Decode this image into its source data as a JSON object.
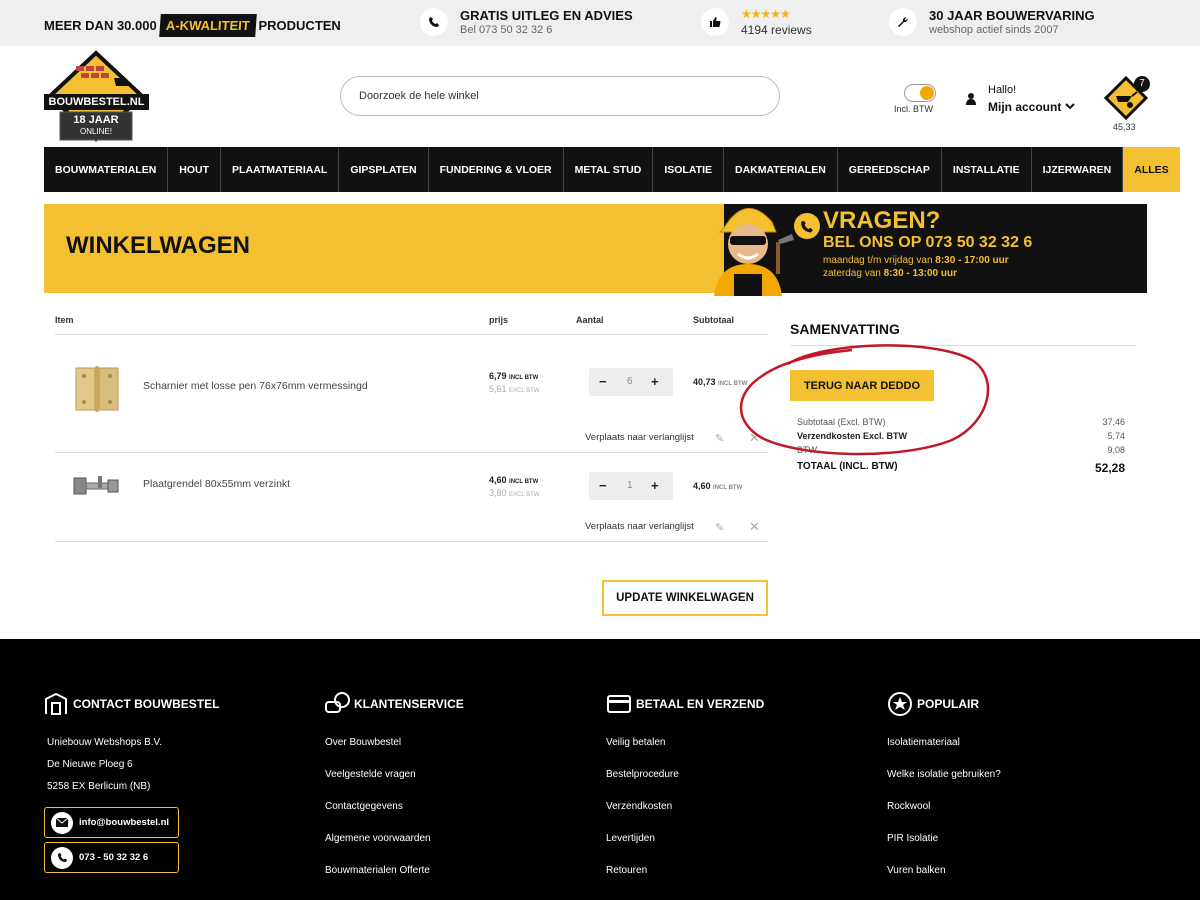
{
  "topbar": {
    "promo_prefix": "MEER DAN 30.000",
    "promo_badge": "A-KWALITEIT",
    "promo_suffix": "PRODUCTEN",
    "advice_title": "GRATIS UITLEG EN ADVIES",
    "advice_sub": "Bel 073 50 32 32 6",
    "review_stars": "★★★★★",
    "review_count": "4194 reviews",
    "experience_title": "30 JAAR BOUWERVARING",
    "experience_sub": "webshop actief sinds 2007"
  },
  "header": {
    "logo_text": "BOUWBESTEL.NL",
    "logo_years": "18 JAAR",
    "logo_online": "ONLINE!",
    "search_placeholder": "Doorzoek de hele winkel",
    "vat_toggle_label": "Incl. BTW",
    "greeting": "Hallo!",
    "account_label": "Mijn account",
    "cart_count": "7",
    "cart_total": "45,33"
  },
  "nav": {
    "items": [
      "BOUWMATERIALEN",
      "HOUT",
      "PLAATMATERIAAL",
      "GIPSPLATEN",
      "FUNDERING & VLOER",
      "METAL STUD",
      "ISOLATIE",
      "DAKMATERIALEN",
      "GEREEDSCHAP",
      "INSTALLATIE",
      "IJZERWAREN",
      "ALLES"
    ]
  },
  "banner": {
    "title": "WINKELWAGEN",
    "question": "VRAGEN?",
    "phone_line": "BEL ONS OP 073 50 32 32 6",
    "hours_weekday_prefix": "maandag t/m vrijdag van ",
    "hours_weekday": "8:30 - 17:00 uur",
    "hours_saturday_prefix": "zaterdag van ",
    "hours_saturday": "8:30 - 13:00 uur"
  },
  "cart": {
    "col_item": "Item",
    "col_price": "prijs",
    "col_qty": "Aantal",
    "col_subtotal": "Subtotaal",
    "incl_label": "INCL BTW",
    "excl_label": "EXCL BTW",
    "wishlist_label": "Verplaats naar verlanglijst",
    "rows": [
      {
        "name": "Scharnier met losse pen 76x76mm vermessingd",
        "price_incl": "6,79",
        "price_excl": "5,61",
        "qty": "6",
        "subtotal": "40,73"
      },
      {
        "name": "Plaatgrendel 80x55mm verzinkt",
        "price_incl": "4,60",
        "price_excl": "3,80",
        "qty": "1",
        "subtotal": "4,60"
      }
    ],
    "update_button": "UPDATE WINKELWAGEN"
  },
  "summary": {
    "title": "SAMENVATTING",
    "back_button": "TERUG NAAR DEDDO",
    "subtotal_label": "Subtotaal (Excl. BTW)",
    "subtotal_value": "37,46",
    "shipping_label": "Verzendkosten Excl. BTW",
    "shipping_value": "5,74",
    "vat_label": "BTW",
    "vat_value": "9,08",
    "total_label": "TOTAAL (INCL. BTW)",
    "total_value": "52,28"
  },
  "footer": {
    "contact": {
      "title": "CONTACT BOUWBESTEL",
      "company": "Uniebouw Webshops B.V.",
      "street": "De Nieuwe Ploeg 6",
      "city": "5258 EX Berlicum (NB)",
      "email": "info@bouwbestel.nl",
      "phone": "073 - 50 32 32 6"
    },
    "service": {
      "title": "KLANTENSERVICE",
      "links": [
        "Over Bouwbestel",
        "Veelgestelde vragen",
        "Contactgegevens",
        "Algemene voorwaarden",
        "Bouwmaterialen Offerte"
      ]
    },
    "payment": {
      "title": "BETAAL EN VERZEND",
      "links": [
        "Veilig betalen",
        "Bestelprocedure",
        "Verzendkosten",
        "Levertijden",
        "Retouren"
      ]
    },
    "popular": {
      "title": "POPULAIR",
      "links": [
        "Isolatiemateriaal",
        "Welke isolatie gebruiken?",
        "Rockwool",
        "PIR Isolatie",
        "Vuren balken"
      ]
    }
  },
  "colors": {
    "brand_yellow": "#f4c031",
    "dark": "#111111",
    "annotation_red": "#c0172a"
  }
}
